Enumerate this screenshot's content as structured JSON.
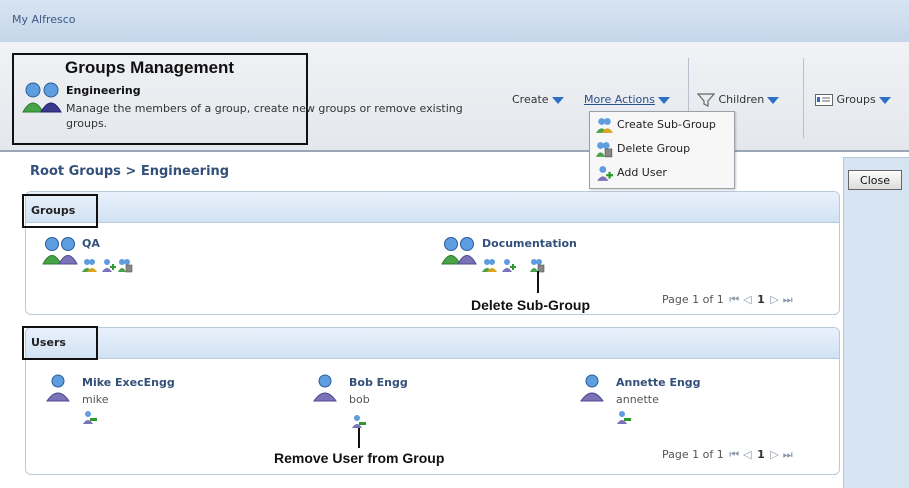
{
  "app": {
    "title": "My Alfresco"
  },
  "header": {
    "title": "Groups Management",
    "subtitle": "Engineering",
    "description": "Manage the members of a group, create new groups or remove existing groups.",
    "icon": "groups-icon"
  },
  "toolbar": {
    "create_label": "Create",
    "more_actions_label": "More Actions",
    "children_label": "Children",
    "groups_label": "Groups"
  },
  "more_actions_menu": [
    {
      "label": "Create Sub-Group",
      "icon": "create-subgroup-icon"
    },
    {
      "label": "Delete Group",
      "icon": "delete-group-icon"
    },
    {
      "label": "Add User",
      "icon": "add-user-icon"
    }
  ],
  "breadcrumb": "Root Groups > Engineering",
  "close_label": "Close",
  "groups_section": {
    "title": "Groups",
    "items": [
      {
        "name": "QA"
      },
      {
        "name": "Documentation"
      }
    ],
    "pager": {
      "text": "Page 1 of 1",
      "current": "1"
    }
  },
  "users_section": {
    "title": "Users",
    "items": [
      {
        "name": "Mike ExecEngg",
        "username": "mike"
      },
      {
        "name": "Bob Engg",
        "username": "bob"
      },
      {
        "name": "Annette Engg",
        "username": "annette"
      }
    ],
    "pager": {
      "text": "Page 1 of 1",
      "current": "1"
    }
  },
  "annotations": {
    "delete_subgroup": "Delete Sub-Group",
    "remove_user": "Remove User from Group"
  },
  "colors": {
    "accent": "#2d6fc2",
    "link": "#2b4f8c",
    "header_bg": "#c5d6ea"
  }
}
